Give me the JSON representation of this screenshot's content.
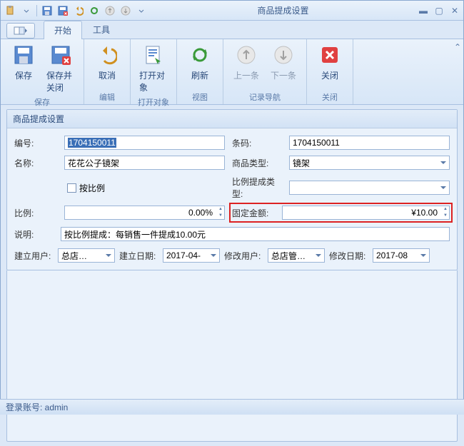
{
  "title": "商品提成设置",
  "tabs": {
    "start": "开始",
    "tools": "工具"
  },
  "ribbon": {
    "save": "保存",
    "saveClose": "保存并关闭",
    "cancel": "取消",
    "openObj": "打开对象",
    "refresh": "刷新",
    "prev": "上一条",
    "next": "下一条",
    "close": "关闭",
    "groupSave": "保存",
    "groupEdit": "编辑",
    "groupOpen": "打开对象",
    "groupView": "视图",
    "groupNav": "记录导航",
    "groupClose": "关闭"
  },
  "panel": {
    "title": "商品提成设置"
  },
  "fields": {
    "codeLabel": "编号:",
    "code": "1704150011",
    "barcodeLabel": "条码:",
    "barcode": "1704150011",
    "nameLabel": "名称:",
    "name": "花花公子镜架",
    "typeLabel": "商品类型:",
    "type": "镜架",
    "byRatio": "按比例",
    "ratioTypeLabel": "比例提成类型:",
    "ratioLabel": "比例:",
    "ratio": "0.00%",
    "fixedLabel": "固定金额:",
    "fixed": "¥10.00",
    "descLabel": "说明:",
    "desc": "按比例提成：每销售一件提成10.00元",
    "createUserLabel": "建立用户:",
    "createUser": "总店…",
    "createDateLabel": "建立日期:",
    "createDate": "2017-04-",
    "modifyUserLabel": "修改用户:",
    "modifyUser": "总店管…",
    "modifyDateLabel": "修改日期:",
    "modifyDate": "2017-08"
  },
  "status": {
    "login": "登录账号: admin"
  }
}
